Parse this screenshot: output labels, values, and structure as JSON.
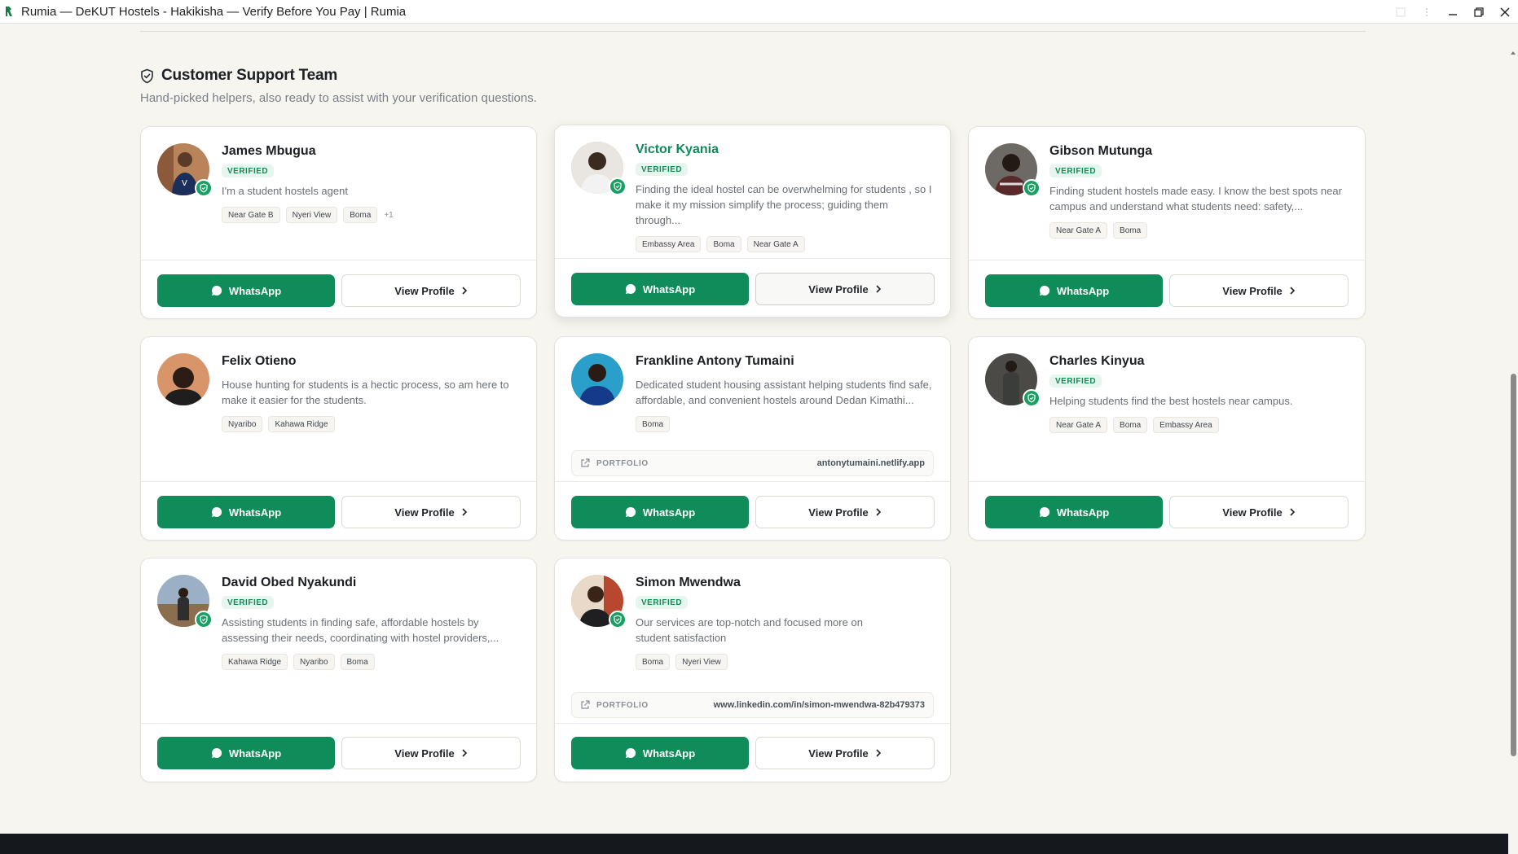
{
  "window": {
    "title": "Rumia — DeKUT Hostels - Hakikisha — Verify Before You Pay | Rumia"
  },
  "section": {
    "title": "Customer Support Team",
    "subtitle": "Hand-picked helpers, also ready to assist with your verification questions."
  },
  "labels": {
    "verified": "VERIFIED",
    "whatsapp": "WhatsApp",
    "view_profile": "View Profile",
    "portfolio": "PORTFOLIO"
  },
  "agents": [
    {
      "name": "James Mbugua",
      "verified": true,
      "bio": "I'm a student hostels agent",
      "tags": [
        "Near Gate B",
        "Nyeri View",
        "Boma"
      ],
      "more": "+1"
    },
    {
      "name": "Victor Kyania",
      "verified": true,
      "bio": "Finding the ideal hostel can be overwhelming for students , so I make it my mission simplify the process; guiding them through...",
      "tags": [
        "Embassy Area",
        "Boma",
        "Near Gate A"
      ]
    },
    {
      "name": "Gibson Mutunga",
      "verified": true,
      "bio": "Finding student hostels made easy. I know the best spots near campus and understand what students need: safety,...",
      "tags": [
        "Near Gate A",
        "Boma"
      ]
    },
    {
      "name": "Felix Otieno",
      "verified": false,
      "bio": "House hunting for students is a hectic process, so am here to make it easier for the students.",
      "tags": [
        "Nyaribo",
        "Kahawa Ridge"
      ]
    },
    {
      "name": "Frankline Antony Tumaini",
      "verified": false,
      "bio": "Dedicated student housing assistant helping students find safe, affordable, and convenient hostels around Dedan Kimathi...",
      "tags": [
        "Boma"
      ],
      "portfolio": "antonytumaini.netlify.app"
    },
    {
      "name": "Charles Kinyua",
      "verified": true,
      "bio": "Helping students find the best hostels near campus.",
      "tags": [
        "Near Gate A",
        "Boma",
        "Embassy Area"
      ]
    },
    {
      "name": "David Obed Nyakundi",
      "verified": true,
      "bio": "Assisting students in finding safe, affordable hostels by assessing their needs, coordinating with hostel providers,...",
      "tags": [
        "Kahawa Ridge",
        "Nyaribo",
        "Boma"
      ]
    },
    {
      "name": "Simon Mwendwa",
      "verified": true,
      "bio": "Our services are top-notch and focused more on student satisfaction",
      "tags": [
        "Boma",
        "Nyeri View"
      ],
      "portfolio": "www.linkedin.com/in/simon-mwendwa-82b479373"
    }
  ],
  "colors": {
    "brand_green": "#0f8c59",
    "accent_name": "#0e8a5a",
    "background": "#f6f5f0"
  }
}
